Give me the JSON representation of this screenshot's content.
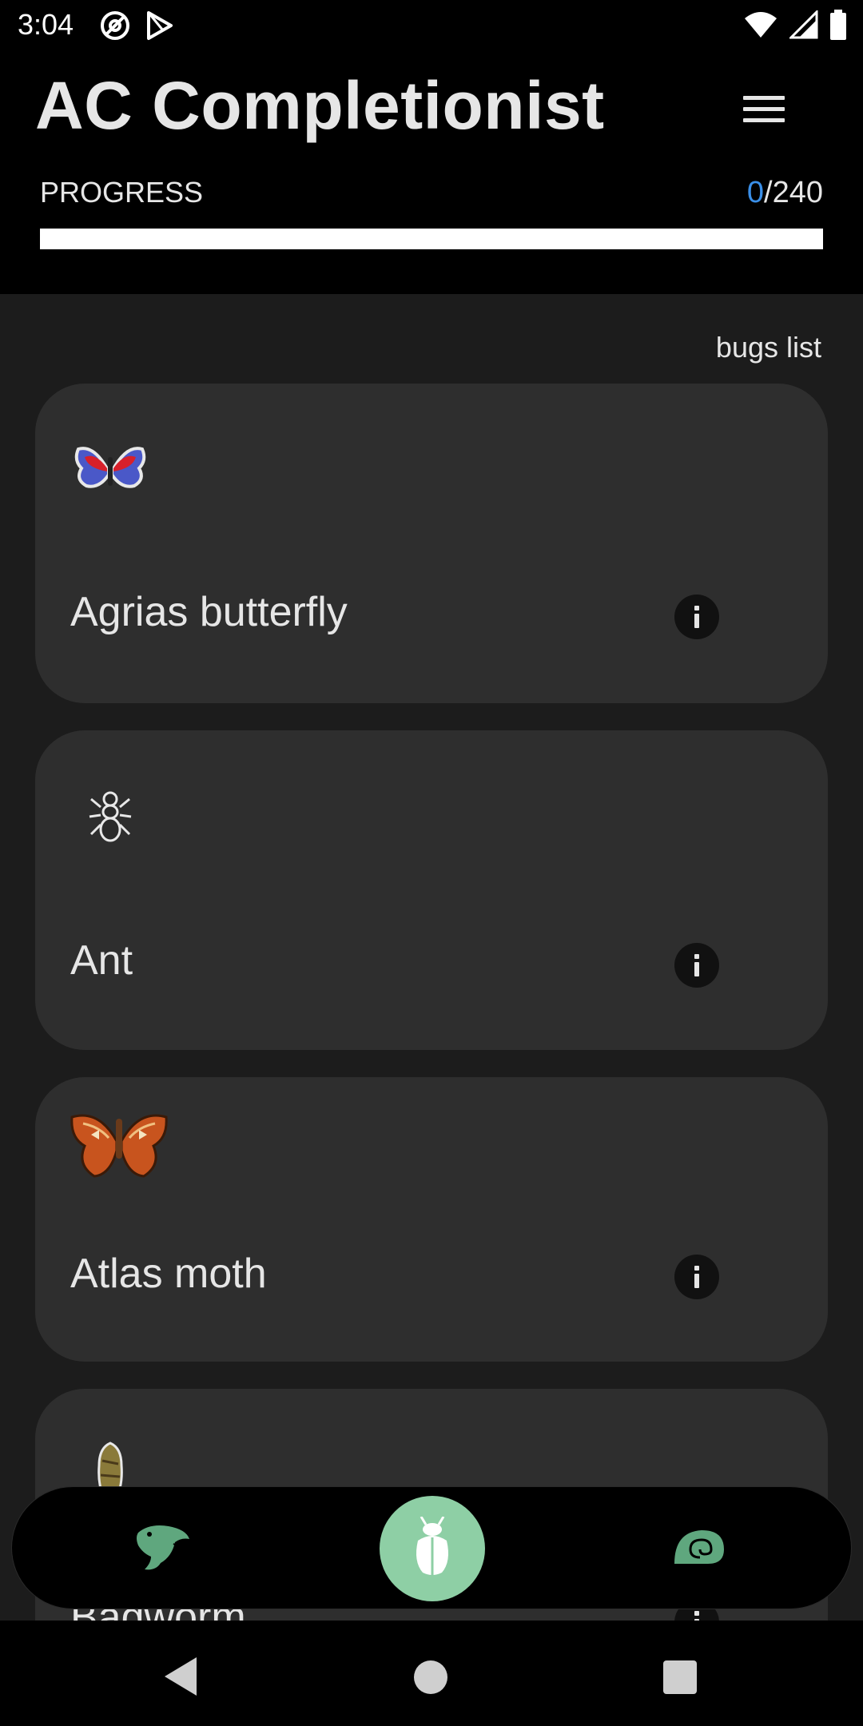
{
  "status_bar": {
    "time": "3:04",
    "left_icons": [
      "at-sign-icon",
      "play-store-icon"
    ],
    "right_icons": [
      "wifi-icon",
      "signal-icon",
      "battery-icon"
    ]
  },
  "header": {
    "title": "AC Completionist",
    "menu_icon": "hamburger-menu-icon",
    "progress_label": "PROGRESS",
    "progress_done": "0",
    "progress_separator": "/",
    "progress_total": "240",
    "progress_fraction": 0
  },
  "main": {
    "list_title": "bugs list",
    "items": [
      {
        "name": "Agrias butterfly",
        "icon": "butterfly-icon"
      },
      {
        "name": "Ant",
        "icon": "ant-icon"
      },
      {
        "name": "Atlas moth",
        "icon": "moth-icon"
      },
      {
        "name": "Bagworm",
        "icon": "bagworm-icon"
      }
    ]
  },
  "tab_bar": {
    "tabs": [
      {
        "name": "fish",
        "icon": "fish-icon",
        "active": false
      },
      {
        "name": "bugs",
        "icon": "bug-icon",
        "active": true
      },
      {
        "name": "fossils",
        "icon": "fossil-icon",
        "active": false
      }
    ]
  },
  "colors": {
    "accent": "#3a8fe8",
    "active_tab": "#8ecfa5",
    "card": "#2e2e2e",
    "background": "#1c1c1c"
  }
}
